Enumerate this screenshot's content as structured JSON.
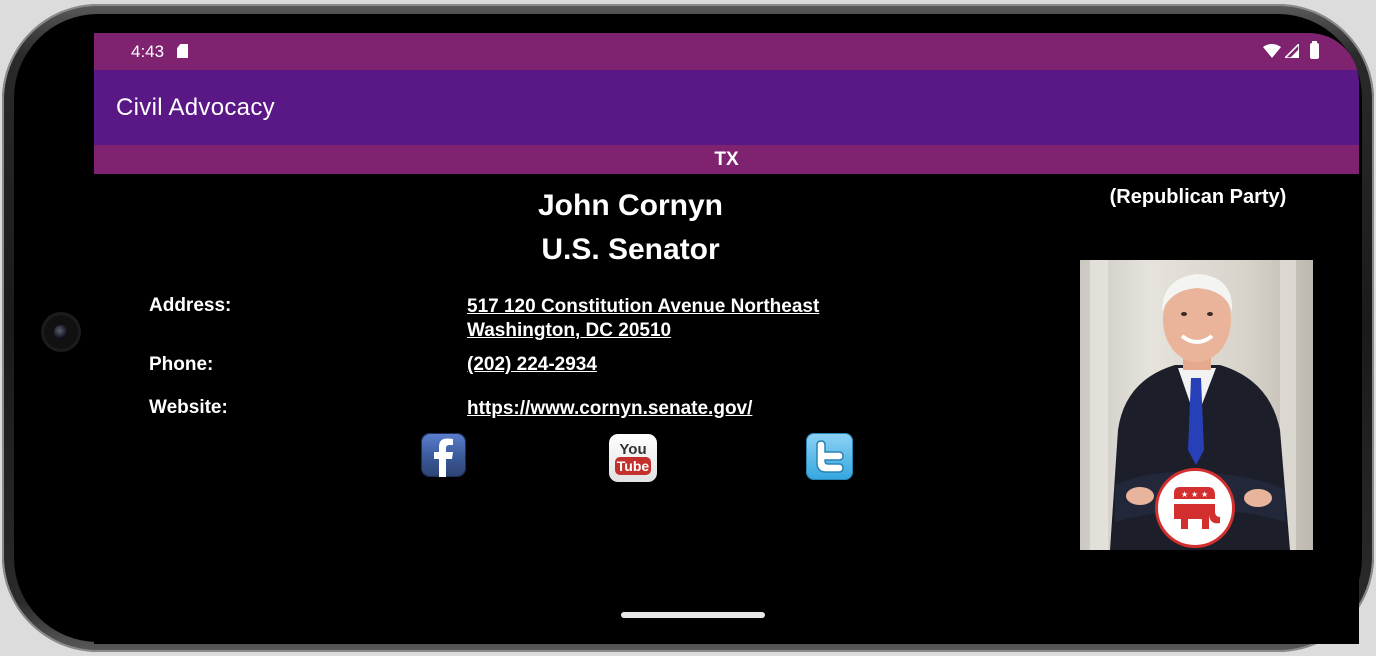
{
  "status_bar": {
    "time": "4:43"
  },
  "app_bar": {
    "title": "Civil Advocacy"
  },
  "location": {
    "state": "TX"
  },
  "official": {
    "name": "John Cornyn",
    "office": "U.S. Senator",
    "party": "(Republican Party)"
  },
  "details": {
    "address_label": "Address:",
    "address_line1": "517 120 Constitution Avenue Northeast",
    "address_line2": "Washington, DC 20510",
    "phone_label": "Phone:",
    "phone_value": "(202) 224-2934",
    "website_label": "Website:",
    "website_value": "https://www.cornyn.senate.gov/"
  },
  "social": {
    "facebook_icon": "facebook-icon",
    "youtube_icon": "youtube-icon",
    "youtube_text_top": "You",
    "youtube_text_bottom": "Tube",
    "twitter_icon": "twitter-icon"
  },
  "colors": {
    "status_bar": "#7f2370",
    "app_bar": "#5a1886",
    "state_bar": "#7f2370",
    "background": "#000000",
    "republican_red": "#d32f2f"
  }
}
